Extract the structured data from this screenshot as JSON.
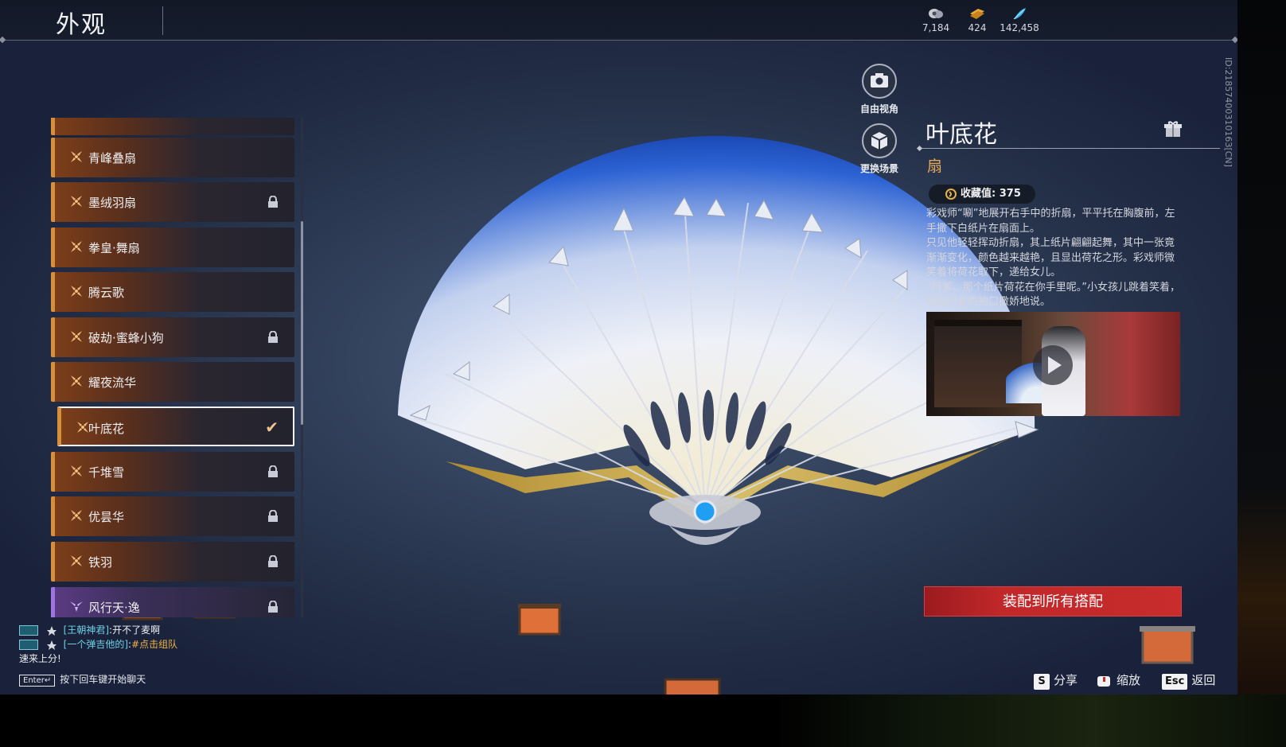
{
  "header": {
    "title": "外观"
  },
  "currencies": [
    {
      "icon": "silver-coin-icon",
      "value": "7,184"
    },
    {
      "icon": "gold-ticket-icon",
      "value": "424"
    },
    {
      "icon": "feather-icon",
      "value": "142,458"
    }
  ],
  "list": {
    "items": [
      {
        "label": "青峰叠扇",
        "locked": false,
        "selected": false
      },
      {
        "label": "墨绒羽扇",
        "locked": true,
        "selected": false
      },
      {
        "label": "拳皇·舞扇",
        "locked": false,
        "selected": false
      },
      {
        "label": "腾云歌",
        "locked": false,
        "selected": false
      },
      {
        "label": "破劫·蜜蜂小狗",
        "locked": true,
        "selected": false
      },
      {
        "label": "耀夜流华",
        "locked": false,
        "selected": false
      },
      {
        "label": "叶底花",
        "locked": false,
        "selected": true
      },
      {
        "label": "千堆雪",
        "locked": true,
        "selected": false
      },
      {
        "label": "优昙华",
        "locked": true,
        "selected": false
      },
      {
        "label": "铁羽",
        "locked": true,
        "selected": false
      },
      {
        "label": "风行天·逸",
        "locked": true,
        "selected": false
      }
    ]
  },
  "camera": {
    "free_view": "自由视角",
    "change_scene": "更换场景"
  },
  "item": {
    "name": "叶底花",
    "type": "扇",
    "collect": "收藏值: 375",
    "desc": [
      "彩戏师“唰”地展开右手中的折扇，平平托在胸腹前，左手撒下白纸片在扇面上。",
      "只见他轻轻挥动折扇，其上纸片翩翩起舞，其中一张竟渐渐变化，颜色越来越艳，且显出荷花之形。彩戏师微笑着将荷花取下，递给女儿。",
      "“阿爹，那个纸片荷花在你手里呢。”小女孩儿跳着笑着，拽着阿爹的袖口撒娇地说。"
    ],
    "equip_all": "装配到所有搭配"
  },
  "uid": "ID:2185740031016З[CN]",
  "chat": {
    "lines": [
      {
        "name": "[王朝神君]",
        "sep": ":",
        "msg": "开不了麦啊",
        "style": "normal"
      },
      {
        "name": "[一个弹吉他的]",
        "sep": ":",
        "msg": "#点击组队",
        "style": "highlight"
      }
    ],
    "extra": "速来上分!",
    "hint_key": "Enter↵",
    "hint": "按下回车键开始聊天"
  },
  "keys": [
    {
      "key": "S",
      "label": "分享"
    },
    {
      "key": "",
      "label": "缩放"
    },
    {
      "key": "Esc",
      "label": "返回"
    }
  ],
  "colors": {
    "accent": "#d78f3a",
    "equip": "#c1282a",
    "type_text": "#e7a955"
  }
}
